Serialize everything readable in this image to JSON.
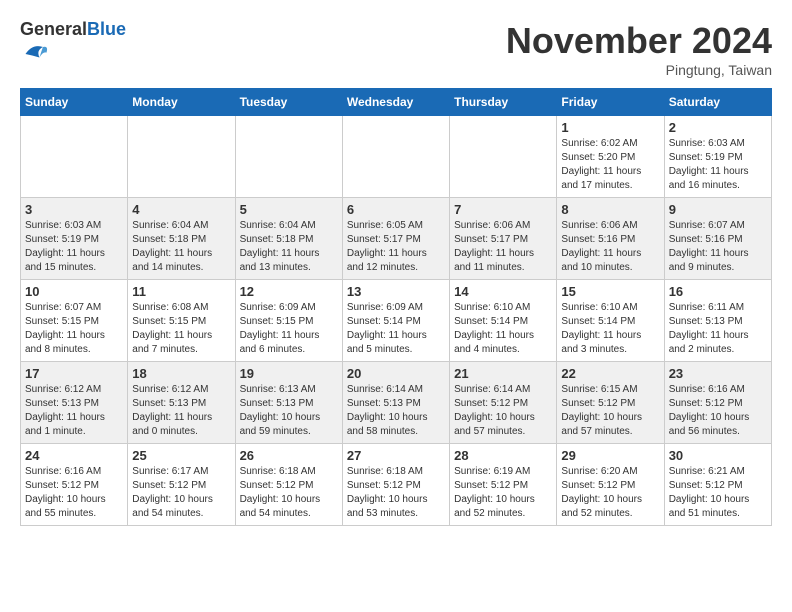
{
  "header": {
    "logo_general": "General",
    "logo_blue": "Blue",
    "month_title": "November 2024",
    "location": "Pingtung, Taiwan"
  },
  "weekdays": [
    "Sunday",
    "Monday",
    "Tuesday",
    "Wednesday",
    "Thursday",
    "Friday",
    "Saturday"
  ],
  "weeks": [
    [
      {
        "day": "",
        "info": ""
      },
      {
        "day": "",
        "info": ""
      },
      {
        "day": "",
        "info": ""
      },
      {
        "day": "",
        "info": ""
      },
      {
        "day": "",
        "info": ""
      },
      {
        "day": "1",
        "info": "Sunrise: 6:02 AM\nSunset: 5:20 PM\nDaylight: 11 hours and 17 minutes."
      },
      {
        "day": "2",
        "info": "Sunrise: 6:03 AM\nSunset: 5:19 PM\nDaylight: 11 hours and 16 minutes."
      }
    ],
    [
      {
        "day": "3",
        "info": "Sunrise: 6:03 AM\nSunset: 5:19 PM\nDaylight: 11 hours and 15 minutes."
      },
      {
        "day": "4",
        "info": "Sunrise: 6:04 AM\nSunset: 5:18 PM\nDaylight: 11 hours and 14 minutes."
      },
      {
        "day": "5",
        "info": "Sunrise: 6:04 AM\nSunset: 5:18 PM\nDaylight: 11 hours and 13 minutes."
      },
      {
        "day": "6",
        "info": "Sunrise: 6:05 AM\nSunset: 5:17 PM\nDaylight: 11 hours and 12 minutes."
      },
      {
        "day": "7",
        "info": "Sunrise: 6:06 AM\nSunset: 5:17 PM\nDaylight: 11 hours and 11 minutes."
      },
      {
        "day": "8",
        "info": "Sunrise: 6:06 AM\nSunset: 5:16 PM\nDaylight: 11 hours and 10 minutes."
      },
      {
        "day": "9",
        "info": "Sunrise: 6:07 AM\nSunset: 5:16 PM\nDaylight: 11 hours and 9 minutes."
      }
    ],
    [
      {
        "day": "10",
        "info": "Sunrise: 6:07 AM\nSunset: 5:15 PM\nDaylight: 11 hours and 8 minutes."
      },
      {
        "day": "11",
        "info": "Sunrise: 6:08 AM\nSunset: 5:15 PM\nDaylight: 11 hours and 7 minutes."
      },
      {
        "day": "12",
        "info": "Sunrise: 6:09 AM\nSunset: 5:15 PM\nDaylight: 11 hours and 6 minutes."
      },
      {
        "day": "13",
        "info": "Sunrise: 6:09 AM\nSunset: 5:14 PM\nDaylight: 11 hours and 5 minutes."
      },
      {
        "day": "14",
        "info": "Sunrise: 6:10 AM\nSunset: 5:14 PM\nDaylight: 11 hours and 4 minutes."
      },
      {
        "day": "15",
        "info": "Sunrise: 6:10 AM\nSunset: 5:14 PM\nDaylight: 11 hours and 3 minutes."
      },
      {
        "day": "16",
        "info": "Sunrise: 6:11 AM\nSunset: 5:13 PM\nDaylight: 11 hours and 2 minutes."
      }
    ],
    [
      {
        "day": "17",
        "info": "Sunrise: 6:12 AM\nSunset: 5:13 PM\nDaylight: 11 hours and 1 minute."
      },
      {
        "day": "18",
        "info": "Sunrise: 6:12 AM\nSunset: 5:13 PM\nDaylight: 11 hours and 0 minutes."
      },
      {
        "day": "19",
        "info": "Sunrise: 6:13 AM\nSunset: 5:13 PM\nDaylight: 10 hours and 59 minutes."
      },
      {
        "day": "20",
        "info": "Sunrise: 6:14 AM\nSunset: 5:13 PM\nDaylight: 10 hours and 58 minutes."
      },
      {
        "day": "21",
        "info": "Sunrise: 6:14 AM\nSunset: 5:12 PM\nDaylight: 10 hours and 57 minutes."
      },
      {
        "day": "22",
        "info": "Sunrise: 6:15 AM\nSunset: 5:12 PM\nDaylight: 10 hours and 57 minutes."
      },
      {
        "day": "23",
        "info": "Sunrise: 6:16 AM\nSunset: 5:12 PM\nDaylight: 10 hours and 56 minutes."
      }
    ],
    [
      {
        "day": "24",
        "info": "Sunrise: 6:16 AM\nSunset: 5:12 PM\nDaylight: 10 hours and 55 minutes."
      },
      {
        "day": "25",
        "info": "Sunrise: 6:17 AM\nSunset: 5:12 PM\nDaylight: 10 hours and 54 minutes."
      },
      {
        "day": "26",
        "info": "Sunrise: 6:18 AM\nSunset: 5:12 PM\nDaylight: 10 hours and 54 minutes."
      },
      {
        "day": "27",
        "info": "Sunrise: 6:18 AM\nSunset: 5:12 PM\nDaylight: 10 hours and 53 minutes."
      },
      {
        "day": "28",
        "info": "Sunrise: 6:19 AM\nSunset: 5:12 PM\nDaylight: 10 hours and 52 minutes."
      },
      {
        "day": "29",
        "info": "Sunrise: 6:20 AM\nSunset: 5:12 PM\nDaylight: 10 hours and 52 minutes."
      },
      {
        "day": "30",
        "info": "Sunrise: 6:21 AM\nSunset: 5:12 PM\nDaylight: 10 hours and 51 minutes."
      }
    ]
  ]
}
